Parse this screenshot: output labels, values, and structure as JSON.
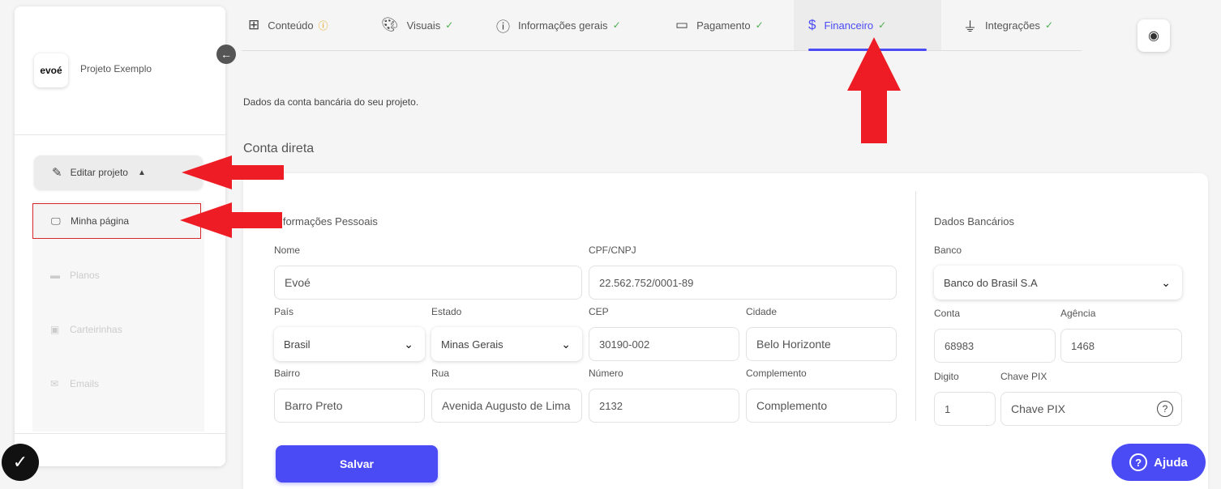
{
  "sidebar": {
    "logo_text": "evoé",
    "project_name": "Projeto Exemplo",
    "edit_project_label": "Editar projeto",
    "items": [
      {
        "label": "Minha página",
        "icon": "monitor-icon"
      },
      {
        "label": "Planos",
        "icon": "ticket-icon"
      },
      {
        "label": "Carteirinhas",
        "icon": "badge-icon"
      },
      {
        "label": "Emails",
        "icon": "envelope-icon"
      }
    ]
  },
  "tabs": [
    {
      "label": "Conteúdo",
      "icon": "grid-icon",
      "status": "warning"
    },
    {
      "label": "Visuais",
      "icon": "palette-icon",
      "status": "ok"
    },
    {
      "label": "Informações gerais",
      "icon": "info-icon",
      "status": "ok"
    },
    {
      "label": "Pagamento",
      "icon": "credit-card-icon",
      "status": "ok"
    },
    {
      "label": "Financeiro",
      "icon": "dollar-icon",
      "status": "ok",
      "active": true
    },
    {
      "label": "Integrações",
      "icon": "plug-icon",
      "status": "ok"
    }
  ],
  "page": {
    "description": "Dados da conta bancária do seu projeto.",
    "section_title": "Conta direta"
  },
  "personal": {
    "title": "Informações Pessoais",
    "nome_label": "Nome",
    "nome_value": "Evoé",
    "cpf_label": "CPF/CNPJ",
    "cpf_value": "22.562.752/0001-89",
    "pais_label": "País",
    "pais_value": "Brasil",
    "estado_label": "Estado",
    "estado_value": "Minas Gerais",
    "cep_label": "CEP",
    "cep_value": "30190-002",
    "cidade_label": "Cidade",
    "cidade_value": "Belo Horizonte",
    "bairro_label": "Bairro",
    "bairro_value": "Barro Preto",
    "rua_label": "Rua",
    "rua_value": "Avenida Augusto de Lima",
    "numero_label": "Número",
    "numero_value": "2132",
    "complemento_label": "Complemento",
    "complemento_placeholder": "Complemento"
  },
  "bank": {
    "title": "Dados Bancários",
    "banco_label": "Banco",
    "banco_value": "Banco do Brasil S.A",
    "conta_label": "Conta",
    "conta_value": "68983",
    "agencia_label": "Agência",
    "agencia_value": "1468",
    "digito_label": "Digito",
    "digito_value": "1",
    "pix_label": "Chave PIX",
    "pix_placeholder": "Chave PIX"
  },
  "actions": {
    "save_label": "Salvar",
    "help_label": "Ajuda"
  },
  "colors": {
    "accent": "#4b4bf5",
    "annotation_arrow": "#ee1c25",
    "ok": "#4caf50",
    "warning": "#e0a000"
  }
}
